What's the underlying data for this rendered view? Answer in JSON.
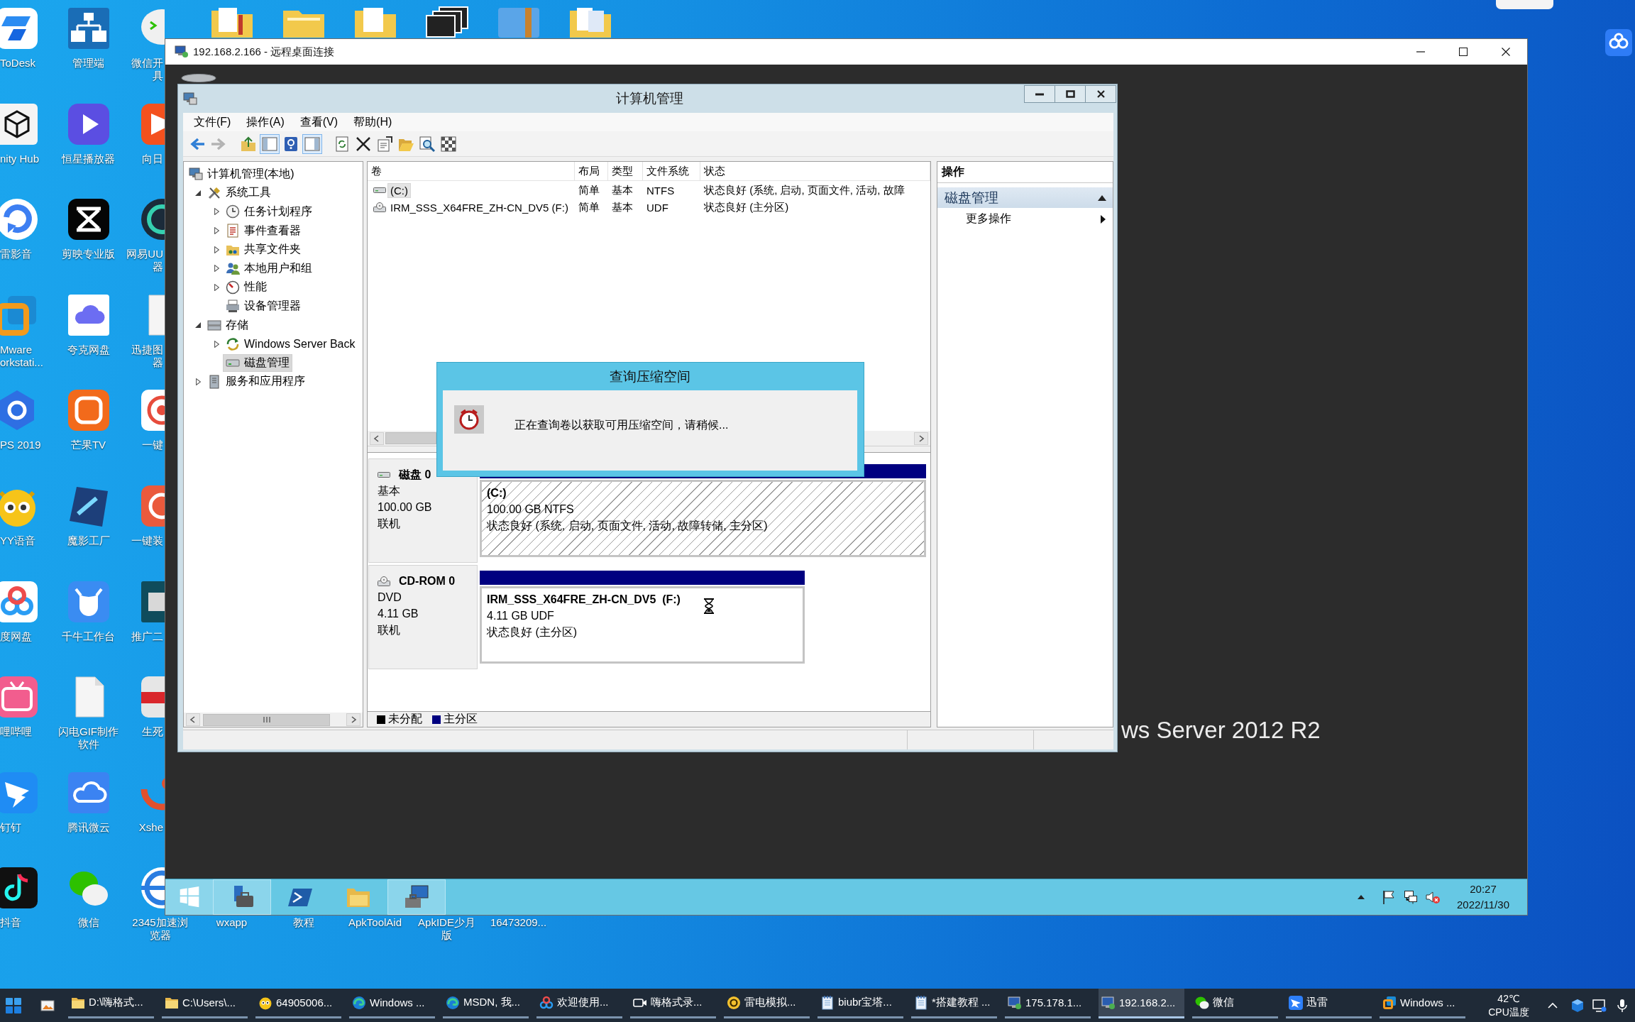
{
  "desktop": {
    "icon_columns": [
      [
        {
          "lines": [
            "ToDesk"
          ]
        },
        {
          "lines": [
            "nity Hub"
          ]
        },
        {
          "lines": [
            "雷影音"
          ]
        },
        {
          "lines": [
            "Mware",
            "orkstati..."
          ]
        },
        {
          "lines": [
            "PS 2019"
          ]
        },
        {
          "lines": [
            "YY语音"
          ]
        },
        {
          "lines": [
            "度网盘"
          ]
        },
        {
          "lines": [
            "哩哔哩"
          ]
        },
        {
          "lines": [
            "钉钉"
          ]
        },
        {
          "lines": [
            "抖音"
          ]
        }
      ],
      [
        {
          "lines": [
            "管理端"
          ]
        },
        {
          "lines": [
            "恒星播放器"
          ]
        },
        {
          "lines": [
            "剪映专业版"
          ]
        },
        {
          "lines": [
            "夸克网盘"
          ]
        },
        {
          "lines": [
            "芒果TV"
          ]
        },
        {
          "lines": [
            "魔影工厂"
          ]
        },
        {
          "lines": [
            "千牛工作台"
          ]
        },
        {
          "lines": [
            "闪电GIF制作",
            "软件"
          ]
        },
        {
          "lines": [
            "腾讯微云"
          ]
        },
        {
          "lines": [
            "微信"
          ]
        }
      ],
      [
        {
          "lines": [
            "微信开",
            "具"
          ]
        },
        {
          "lines": [
            "向日"
          ]
        },
        {
          "lines": [
            "网易UU",
            "器"
          ]
        },
        {
          "lines": [
            "迅捷图",
            "器"
          ]
        },
        {
          "lines": [
            "一键"
          ]
        },
        {
          "lines": [
            "一键装"
          ]
        },
        {
          "lines": [
            "推广二"
          ]
        },
        {
          "lines": [
            "生死"
          ]
        },
        {
          "lines": [
            "Xshe"
          ]
        },
        {
          "lines": [
            "2345加速浏",
            "览器"
          ]
        }
      ]
    ],
    "bottom_labels": [
      {
        "lines": [
          "wxapp"
        ]
      },
      {
        "lines": [
          "教程"
        ]
      },
      {
        "lines": [
          "ApkToolAid"
        ]
      },
      {
        "lines": [
          "ApkIDE少月",
          "版"
        ]
      },
      {
        "lines": [
          "16473209..."
        ]
      }
    ]
  },
  "remote_window": {
    "title": "192.168.2.166 - 远程桌面连接",
    "wallpaper_text": "ws Server 2012 R2",
    "app_window": {
      "title": "计算机管理",
      "menu": [
        "文件(F)",
        "操作(A)",
        "查看(V)",
        "帮助(H)"
      ],
      "toolbar": [
        [
          {
            "pressed": false,
            "disabled": false
          },
          {
            "pressed": false,
            "disabled": true
          }
        ],
        [
          {
            "pressed": false,
            "disabled": false
          },
          {
            "pressed": true,
            "disabled": false
          },
          {
            "pressed": false,
            "disabled": false
          },
          {
            "pressed": true,
            "disabled": false
          }
        ],
        [
          {
            "pressed": false,
            "disabled": false
          },
          {
            "pressed": false,
            "disabled": false
          },
          {
            "pressed": false,
            "disabled": false
          },
          {
            "pressed": false,
            "disabled": false
          },
          {
            "pressed": false,
            "disabled": false
          },
          {
            "pressed": false,
            "disabled": false
          }
        ]
      ],
      "tree": [
        {
          "label": "计算机管理(本地)",
          "kind": "root",
          "selected": false,
          "children": [
            {
              "label": "系统工具",
              "kind": "branch",
              "expanded": true,
              "selected": false,
              "children": [
                {
                  "label": "任务计划程序",
                  "kind": "branch",
                  "expanded": false,
                  "selected": false
                },
                {
                  "label": "事件查看器",
                  "kind": "branch",
                  "expanded": false,
                  "selected": false
                },
                {
                  "label": "共享文件夹",
                  "kind": "branch",
                  "expanded": false,
                  "selected": false
                },
                {
                  "label": "本地用户和组",
                  "kind": "branch",
                  "expanded": false,
                  "selected": false
                },
                {
                  "label": "性能",
                  "kind": "branch",
                  "expanded": false,
                  "selected": false
                },
                {
                  "label": "设备管理器",
                  "kind": "leaf",
                  "selected": false
                }
              ]
            },
            {
              "label": "存储",
              "kind": "branch",
              "expanded": true,
              "selected": false,
              "children": [
                {
                  "label": "Windows Server Back",
                  "kind": "branch",
                  "expanded": false,
                  "selected": false
                },
                {
                  "label": "磁盘管理",
                  "kind": "leaf",
                  "selected": true
                }
              ]
            },
            {
              "label": "服务和应用程序",
              "kind": "branch",
              "expanded": false,
              "selected": false
            }
          ]
        }
      ],
      "volume_list": {
        "columns": [
          "卷",
          "布局",
          "类型",
          "文件系统",
          "状态"
        ],
        "rows": [
          {
            "selected": true,
            "cells": [
              "(C:)",
              "简单",
              "基本",
              "NTFS",
              "状态良好 (系统, 启动, 页面文件, 活动, 故障"
            ]
          },
          {
            "selected": false,
            "cells": [
              "IRM_SSS_X64FRE_ZH-CN_DV5 (F:)",
              "简单",
              "基本",
              "UDF",
              "状态良好 (主分区)"
            ]
          }
        ]
      },
      "disks": [
        {
          "name": "磁盘 0",
          "type": "基本",
          "size": "100.00 GB",
          "status": "联机",
          "partitions": [
            {
              "name": "(C:)",
              "detail": "100.00 GB NTFS",
              "status": "状态良好 (系统, 启动, 页面文件, 活动, 故障转储, 主分区)",
              "selected": true
            }
          ]
        },
        {
          "name": "CD-ROM 0",
          "type": "DVD",
          "size": "4.11 GB",
          "status": "联机",
          "partitions": [
            {
              "name": "IRM_SSS_X64FRE_ZH-CN_DV5  (F:)",
              "detail": "4.11 GB UDF",
              "status": "状态良好 (主分区)",
              "selected": false
            }
          ]
        }
      ],
      "legend": [
        {
          "label": "未分配",
          "color": "#000000"
        },
        {
          "label": "主分区",
          "color": "#000080"
        }
      ],
      "actions": {
        "title": "操作",
        "section": {
          "label": "磁盘管理",
          "expanded": true
        },
        "items": [
          "更多操作"
        ]
      }
    },
    "dialog": {
      "title": "查询压缩空间",
      "message": "正在查询卷以获取可用压缩空间，请稍候..."
    },
    "taskbar": {
      "apps": [
        {
          "open": true
        },
        {
          "open": false
        },
        {
          "open": false
        },
        {
          "open": true
        }
      ],
      "time": "20:27",
      "date": "2022/11/30"
    }
  },
  "taskbar": {
    "items": [
      {
        "label": "D:\\嗨格式...",
        "selected": false
      },
      {
        "label": "C:\\Users\\...",
        "selected": false
      },
      {
        "label": "64905006...",
        "selected": false
      },
      {
        "label": "Windows ...",
        "selected": false
      },
      {
        "label": "MSDN, 我...",
        "selected": false
      },
      {
        "label": "欢迎使用...",
        "selected": false
      },
      {
        "label": "嗨格式录...",
        "selected": false
      },
      {
        "label": "雷电模拟...",
        "selected": false
      },
      {
        "label": "biubr宝塔...",
        "selected": false
      },
      {
        "label": "*搭建教程 ...",
        "selected": false
      },
      {
        "label": "175.178.1...",
        "selected": false
      },
      {
        "label": "192.168.2...",
        "selected": true
      },
      {
        "label": "微信",
        "selected": false
      },
      {
        "label": "迅雷",
        "selected": false
      },
      {
        "label": "Windows ...",
        "selected": false
      }
    ],
    "temperature": "42℃",
    "temperature_label": "CPU温度"
  }
}
